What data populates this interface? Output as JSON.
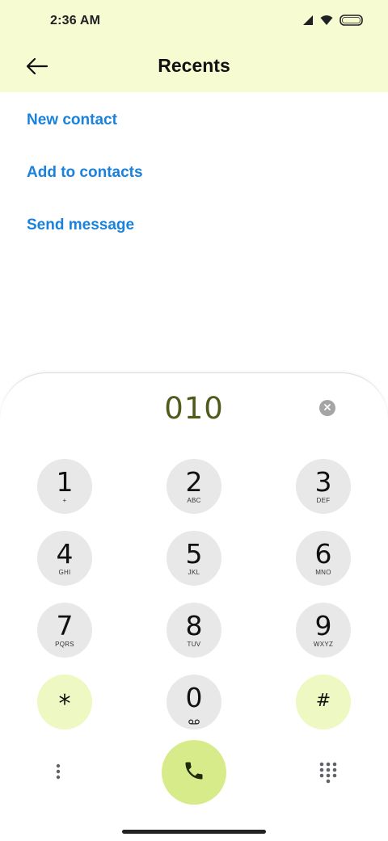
{
  "status_bar": {
    "time": "2:36 AM",
    "icons": [
      "cell-signal-icon",
      "wifi-icon",
      "battery-icon"
    ]
  },
  "app_bar": {
    "title": "Recents",
    "back_icon": "arrow-left-icon"
  },
  "actions": [
    {
      "label": "New contact"
    },
    {
      "label": "Add to contacts"
    },
    {
      "label": "Send message"
    }
  ],
  "dialpad": {
    "number": "010",
    "clear_icon": "clear-x-icon",
    "keys": [
      {
        "digit": "1",
        "letters": "+"
      },
      {
        "digit": "2",
        "letters": "ABC"
      },
      {
        "digit": "3",
        "letters": "DEF"
      },
      {
        "digit": "4",
        "letters": "GHI"
      },
      {
        "digit": "5",
        "letters": "JKL"
      },
      {
        "digit": "6",
        "letters": "MNO"
      },
      {
        "digit": "7",
        "letters": "PQRS"
      },
      {
        "digit": "8",
        "letters": "TUV"
      },
      {
        "digit": "9",
        "letters": "WXYZ"
      },
      {
        "digit": "*"
      },
      {
        "digit": "0",
        "letters_icon": "voicemail-icon"
      },
      {
        "digit": "#"
      }
    ],
    "more_icon": "more-vertical-icon",
    "call_icon": "phone-icon",
    "dialpad_icon": "dialpad-grid-icon"
  },
  "colors": {
    "header_bg": "#f6fbd2",
    "link": "#1a82dc",
    "number": "#505a1c",
    "key_bg": "#e8e8e8",
    "key_accent_bg": "#edf8c2",
    "call_bg": "#d8eb8a"
  }
}
